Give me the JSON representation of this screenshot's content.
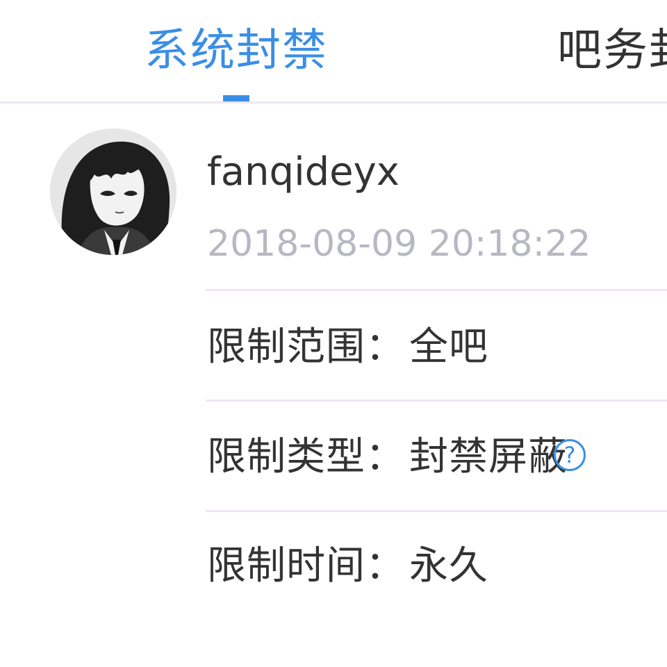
{
  "tabs": [
    {
      "label": "系统封禁",
      "active": true
    },
    {
      "label": "吧务封",
      "active": false
    }
  ],
  "user": {
    "username": "fanqideyx",
    "timestamp": "2018-08-09 20:18:22"
  },
  "ban_info": {
    "scope_label": "限制范围：",
    "scope_value": "全吧",
    "type_label": "限制类型：",
    "type_value": "封禁屏蔽",
    "duration_label": "限制时间：",
    "duration_value": "永久"
  },
  "icons": {
    "help": "question-circle-icon",
    "help_glyph": "?"
  },
  "colors": {
    "accent": "#3a8ee6",
    "text": "#333333",
    "muted": "#b8b8c2",
    "divider": "#efe6f2"
  }
}
